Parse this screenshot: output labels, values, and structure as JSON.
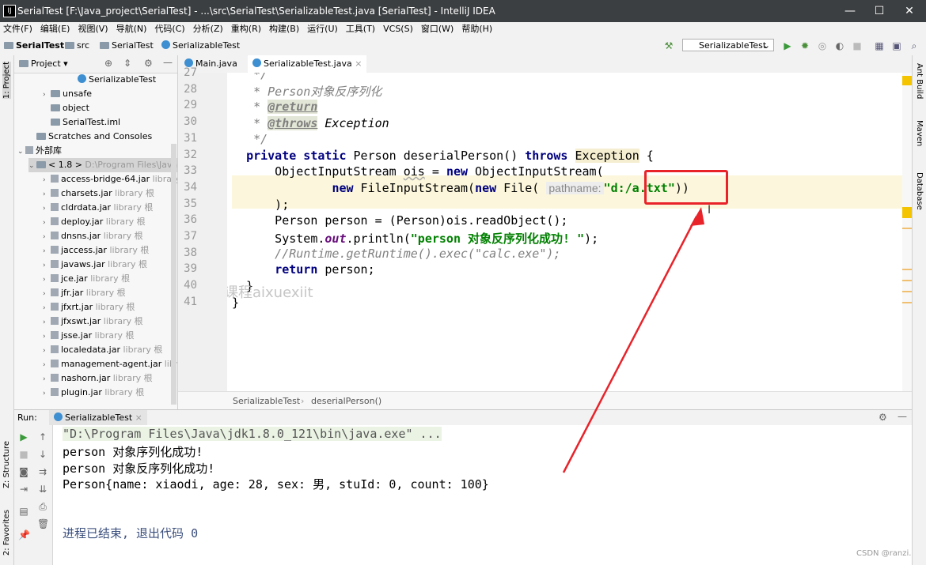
{
  "window": {
    "title": "SerialTest [F:\\Java_project\\SerialTest] - ...\\src\\SerialTest\\SerializableTest.java [SerialTest] - IntelliJ IDEA",
    "minimize": "—",
    "maximize": "☐",
    "close": "✕"
  },
  "menu": [
    "文件(F)",
    "编辑(E)",
    "视图(V)",
    "导航(N)",
    "代码(C)",
    "分析(Z)",
    "重构(R)",
    "构建(B)",
    "运行(U)",
    "工具(T)",
    "VCS(S)",
    "窗口(W)",
    "帮助(H)"
  ],
  "breadcrumb": [
    "SerialTest",
    "src",
    "SerialTest",
    "SerializableTest"
  ],
  "run_config": "SerializableTest",
  "left_tabs": [
    "1: Project",
    "Z: Structure",
    "2: Favorites"
  ],
  "right_tabs": [
    "Ant Build",
    "Maven",
    "Database"
  ],
  "project": {
    "header": "Project",
    "rows": [
      {
        "text": "SerializableTest",
        "suffix": "",
        "indent": 70,
        "arrow": "",
        "kind": "class"
      },
      {
        "text": "unsafe",
        "suffix": "",
        "indent": 36,
        "arrow": "›",
        "kind": "folder"
      },
      {
        "text": "object",
        "suffix": "",
        "indent": 36,
        "arrow": "",
        "kind": "folder"
      },
      {
        "text": "SerialTest.iml",
        "suffix": "",
        "indent": 36,
        "arrow": "",
        "kind": "file"
      },
      {
        "text": "Scratches and Consoles",
        "suffix": "",
        "indent": 18,
        "arrow": "",
        "kind": "file"
      },
      {
        "text": "外部库",
        "suffix": "",
        "indent": 4,
        "arrow": "⌄",
        "kind": "lib"
      },
      {
        "text": "< 1.8 >",
        "suffix": "D:\\Program Files\\Java\\",
        "indent": 18,
        "arrow": "⌄",
        "kind": "folder"
      },
      {
        "text": "access-bridge-64.jar",
        "suffix": "library",
        "indent": 36,
        "arrow": "›",
        "kind": "jar"
      },
      {
        "text": "charsets.jar",
        "suffix": "library 根",
        "indent": 36,
        "arrow": "›",
        "kind": "jar"
      },
      {
        "text": "cldrdata.jar",
        "suffix": "library 根",
        "indent": 36,
        "arrow": "›",
        "kind": "jar"
      },
      {
        "text": "deploy.jar",
        "suffix": "library 根",
        "indent": 36,
        "arrow": "›",
        "kind": "jar"
      },
      {
        "text": "dnsns.jar",
        "suffix": "library 根",
        "indent": 36,
        "arrow": "›",
        "kind": "jar"
      },
      {
        "text": "jaccess.jar",
        "suffix": "library 根",
        "indent": 36,
        "arrow": "›",
        "kind": "jar"
      },
      {
        "text": "javaws.jar",
        "suffix": "library 根",
        "indent": 36,
        "arrow": "›",
        "kind": "jar"
      },
      {
        "text": "jce.jar",
        "suffix": "library 根",
        "indent": 36,
        "arrow": "›",
        "kind": "jar"
      },
      {
        "text": "jfr.jar",
        "suffix": "library 根",
        "indent": 36,
        "arrow": "›",
        "kind": "jar"
      },
      {
        "text": "jfxrt.jar",
        "suffix": "library 根",
        "indent": 36,
        "arrow": "›",
        "kind": "jar"
      },
      {
        "text": "jfxswt.jar",
        "suffix": "library 根",
        "indent": 36,
        "arrow": "›",
        "kind": "jar"
      },
      {
        "text": "jsse.jar",
        "suffix": "library 根",
        "indent": 36,
        "arrow": "›",
        "kind": "jar"
      },
      {
        "text": "localedata.jar",
        "suffix": "library 根",
        "indent": 36,
        "arrow": "›",
        "kind": "jar"
      },
      {
        "text": "management-agent.jar",
        "suffix": "libra",
        "indent": 36,
        "arrow": "›",
        "kind": "jar"
      },
      {
        "text": "nashorn.jar",
        "suffix": "library 根",
        "indent": 36,
        "arrow": "›",
        "kind": "jar"
      },
      {
        "text": "plugin.jar",
        "suffix": "library 根",
        "indent": 36,
        "arrow": "›",
        "kind": "jar"
      }
    ]
  },
  "tabs": [
    {
      "label": "Main.java",
      "close": "×"
    },
    {
      "label": "SerializableTest.java",
      "close": "×"
    }
  ],
  "editor": {
    "line_numbers": [
      "27",
      "28",
      "29",
      "30",
      "31",
      "32",
      "33",
      "34",
      "35",
      "36",
      "37",
      "38",
      "39",
      "40",
      "41"
    ],
    "hint_label": "pathname:",
    "path_string": "\"d:/a.txt\"",
    "watermark": "一手课程aixuexiit",
    "crumb_class": "SerializableTest",
    "crumb_method": "deserialPerson()"
  },
  "run": {
    "label": "Run:",
    "tab": "SerializableTest",
    "lines": [
      "\"D:\\Program Files\\Java\\jdk1.8.0_121\\bin\\java.exe\" ...",
      "person 对象序列化成功!",
      "person 对象反序列化成功!",
      "Person{name: xiaodi, age: 28, sex: 男, stuId: 0, count: 100}",
      "",
      "进程已结束, 退出代码 0"
    ]
  },
  "credit": "CSDN @ranzi.",
  "colors": {
    "highlight_box": "#e8232a",
    "arrow": "#e8232a",
    "line_highlight": "#fcf7dc"
  }
}
